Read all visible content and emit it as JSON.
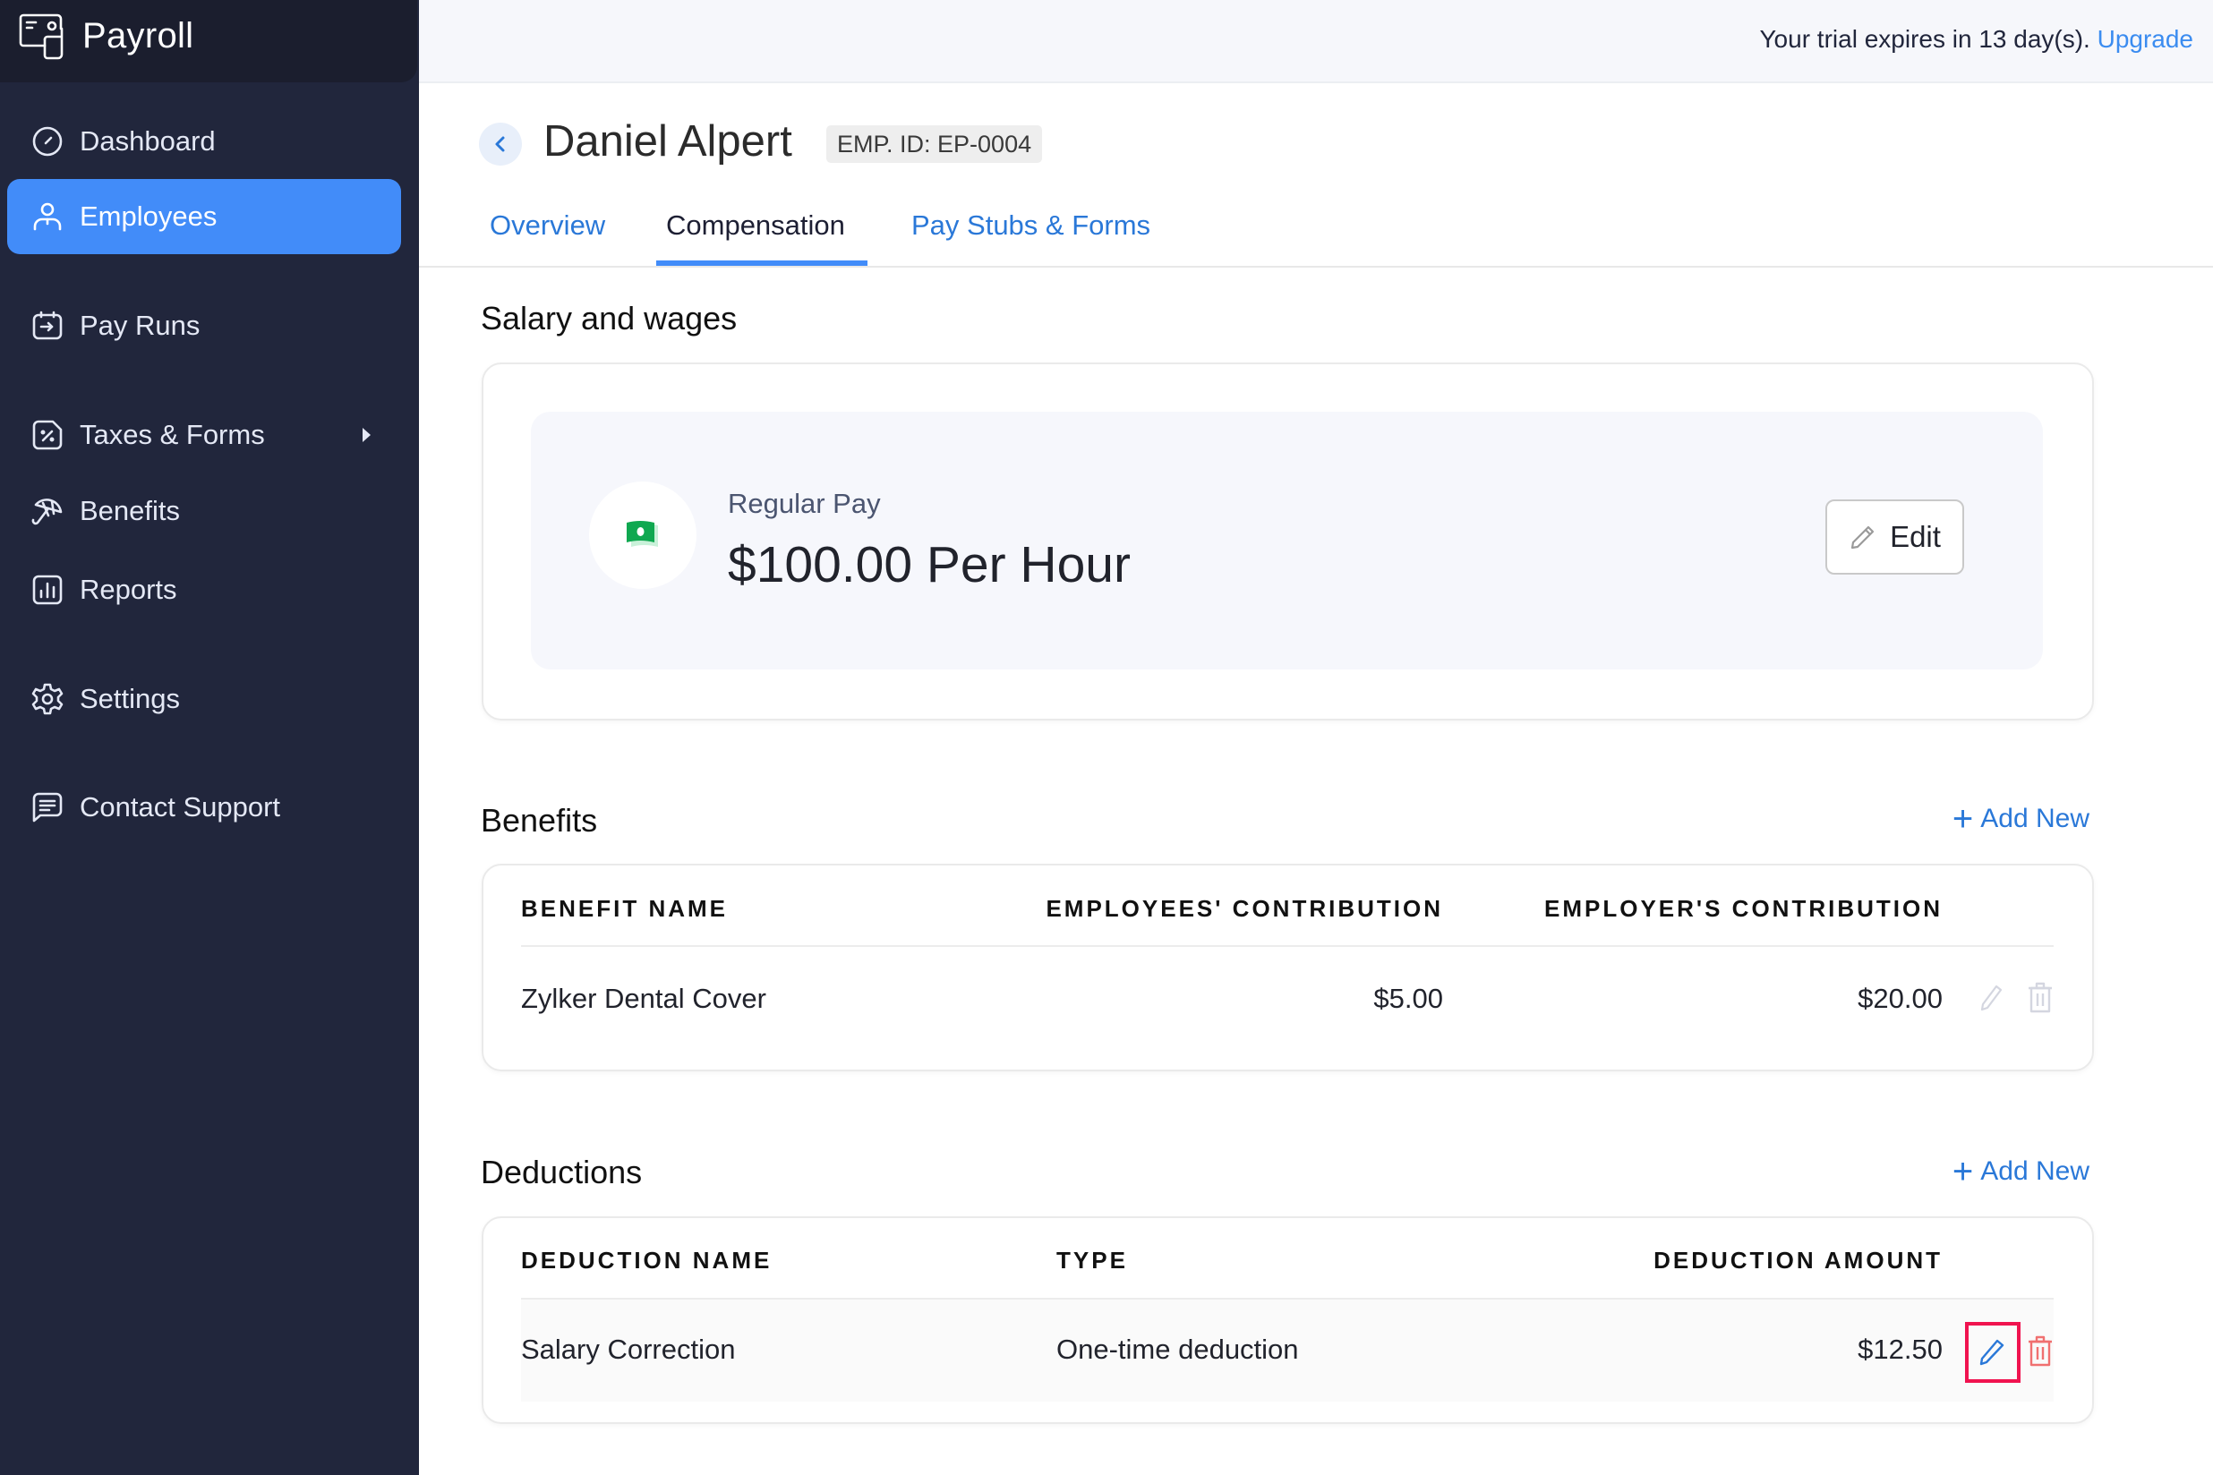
{
  "app": {
    "name": "Payroll"
  },
  "sidebar": {
    "items": [
      {
        "label": "Dashboard",
        "icon": "dashboard-gauge-icon",
        "active": false
      },
      {
        "label": "Employees",
        "icon": "user-icon",
        "active": true
      },
      {
        "label": "Pay Runs",
        "icon": "pay-runs-calendar-icon",
        "active": false
      },
      {
        "label": "Taxes & Forms",
        "icon": "percent-tax-icon",
        "active": false,
        "has_submenu": true
      },
      {
        "label": "Benefits",
        "icon": "umbrella-icon",
        "active": false
      },
      {
        "label": "Reports",
        "icon": "bar-chart-icon",
        "active": false
      },
      {
        "label": "Settings",
        "icon": "gear-icon",
        "active": false
      },
      {
        "label": "Contact Support",
        "icon": "chat-icon",
        "active": false
      }
    ]
  },
  "topbar": {
    "trial_text": "Your trial expires in 13 day(s).",
    "upgrade_label": "Upgrade"
  },
  "employee": {
    "name": "Daniel Alpert",
    "emp_id": "EMP. ID: EP-0004"
  },
  "tabs": [
    {
      "label": "Overview",
      "active": false
    },
    {
      "label": "Compensation",
      "active": true
    },
    {
      "label": "Pay Stubs & Forms",
      "active": false
    }
  ],
  "salary": {
    "title": "Salary and wages",
    "pay_label": "Regular Pay",
    "pay_amount": "$100.00 Per Hour",
    "edit_label": "Edit"
  },
  "benefits": {
    "title": "Benefits",
    "add_label": "Add New",
    "columns": [
      "BENEFIT NAME",
      "EMPLOYEES' CONTRIBUTION",
      "EMPLOYER'S CONTRIBUTION"
    ],
    "rows": [
      {
        "name": "Zylker Dental Cover",
        "employee_contribution": "$5.00",
        "employer_contribution": "$20.00"
      }
    ]
  },
  "deductions": {
    "title": "Deductions",
    "add_label": "Add New",
    "columns": [
      "DEDUCTION NAME",
      "TYPE",
      "DEDUCTION AMOUNT"
    ],
    "rows": [
      {
        "name": "Salary Correction",
        "type": "One-time deduction",
        "amount": "$12.50"
      }
    ]
  },
  "colors": {
    "sidebar_bg": "#21263c",
    "active_nav": "#428cf9",
    "link": "#2a78d8",
    "delete_red": "#f07070",
    "focus_highlight": "#f0134f",
    "money_green": "#0fa850"
  }
}
